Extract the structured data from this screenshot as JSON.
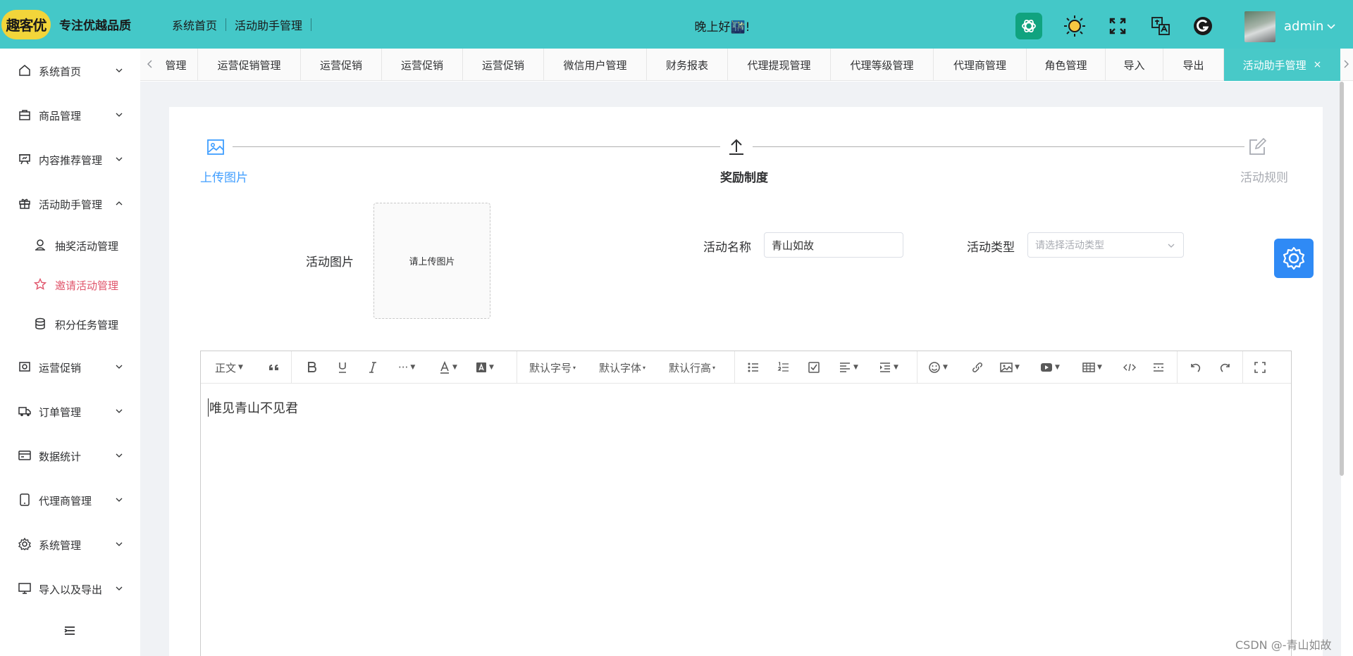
{
  "header": {
    "logo_text": "趣客优",
    "slogan": "专注优越品质",
    "breadcrumbs": [
      "系统首页",
      "活动助手管理"
    ],
    "greeting": "晚上好🌃!",
    "user_name": "admin",
    "icons": [
      "chatgpt-icon",
      "sun-icon",
      "fullscreen-icon",
      "translate-icon",
      "g-logo-icon"
    ],
    "accent_color": "#44c8c8"
  },
  "sidebar": {
    "items": [
      {
        "label": "系统首页",
        "icon": "home-icon"
      },
      {
        "label": "商品管理",
        "icon": "bag-icon"
      },
      {
        "label": "内容推荐管理",
        "icon": "board-icon"
      },
      {
        "label": "活动助手管理",
        "icon": "gift-icon",
        "expanded": true
      },
      {
        "label": "运营促销",
        "icon": "promo-icon"
      },
      {
        "label": "订单管理",
        "icon": "truck-icon"
      },
      {
        "label": "数据统计",
        "icon": "card-icon"
      },
      {
        "label": "代理商管理",
        "icon": "tablet-icon"
      },
      {
        "label": "系统管理",
        "icon": "gear-icon"
      },
      {
        "label": "导入以及导出",
        "icon": "monitor-icon"
      }
    ],
    "sub_items": [
      {
        "label": "抽奖活动管理",
        "icon": "user-icon"
      },
      {
        "label": "邀请活动管理",
        "icon": "star-icon",
        "active": true
      },
      {
        "label": "积分任务管理",
        "icon": "coins-icon"
      }
    ],
    "active_color": "#e0556b"
  },
  "tabs": [
    {
      "label": "管理"
    },
    {
      "label": "运营促销管理"
    },
    {
      "label": "运营促销"
    },
    {
      "label": "运营促销"
    },
    {
      "label": "运营促销"
    },
    {
      "label": "微信用户管理"
    },
    {
      "label": "财务报表"
    },
    {
      "label": "代理提现管理"
    },
    {
      "label": "代理等级管理"
    },
    {
      "label": "代理商管理"
    },
    {
      "label": "角色管理"
    },
    {
      "label": "导入"
    },
    {
      "label": "导出"
    },
    {
      "label": "活动助手管理",
      "active": true,
      "close": "×"
    }
  ],
  "steps": [
    {
      "title": "上传图片",
      "status": "done",
      "icon": "image-icon"
    },
    {
      "title": "奖励制度",
      "status": "current",
      "icon": "upload-icon"
    },
    {
      "title": "活动规则",
      "status": "wait",
      "icon": "edit-icon"
    }
  ],
  "form": {
    "image_label": "活动图片",
    "upload_text": "请上传图片",
    "name_label": "活动名称",
    "name_value": "青山如故",
    "type_label": "活动类型",
    "type_placeholder": "请选择活动类型"
  },
  "editor": {
    "toolbar": {
      "paragraph": "正文",
      "font_size": "默认字号",
      "font_family": "默认字体",
      "line_height": "默认行高"
    },
    "content": "唯见青山不见君"
  },
  "watermark": "CSDN @-青山如故"
}
